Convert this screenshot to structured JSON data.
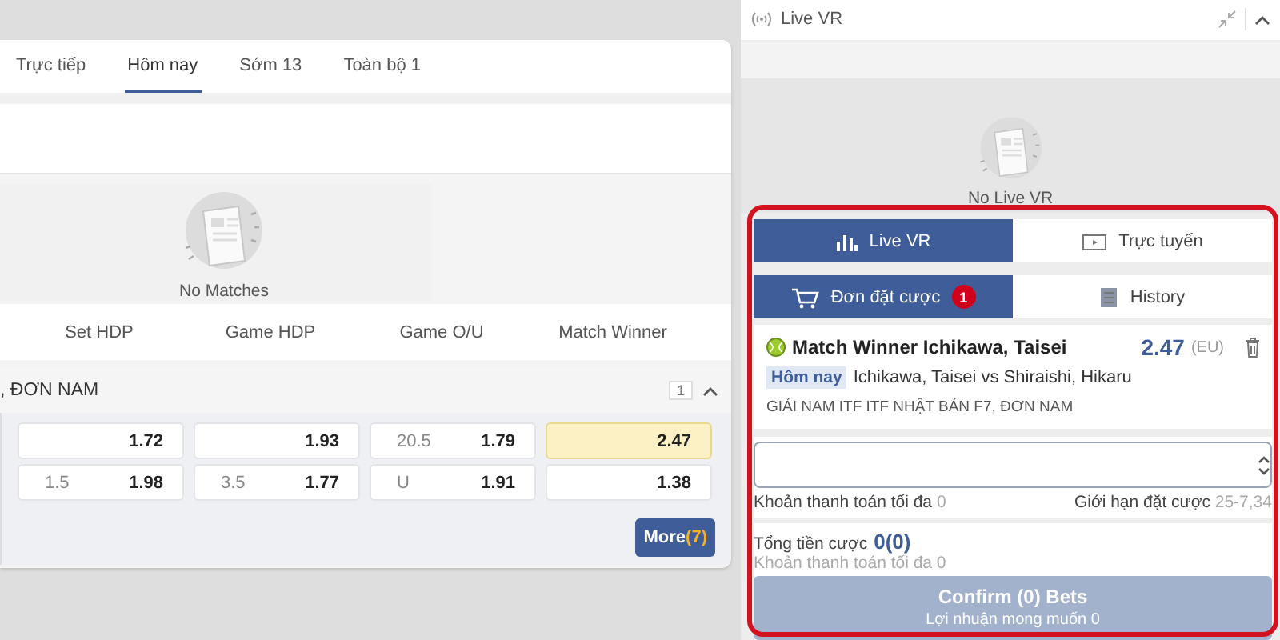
{
  "market_tabs": [
    {
      "label": "Trực tiếp",
      "selected": false
    },
    {
      "label": "Hôm nay",
      "selected": true
    },
    {
      "label": "Sớm 13",
      "selected": false
    },
    {
      "label": "Toàn bộ 1",
      "selected": false
    }
  ],
  "empty_state": {
    "message": "No Matches"
  },
  "columns": [
    "Set HDP",
    "Game HDP",
    "Game O/U",
    "Match Winner"
  ],
  "league": {
    "name": ", ĐƠN NAM",
    "count": "1",
    "expanded": true
  },
  "odds_rows": [
    [
      {
        "price": "1.72",
        "selected": false
      },
      {
        "price": "1.93",
        "selected": false
      },
      {
        "line": "20.5",
        "price": "1.79",
        "selected": false
      },
      {
        "price": "2.47",
        "selected": true
      }
    ],
    [
      {
        "line": "1.5",
        "price": "1.98",
        "selected": false
      },
      {
        "line": "3.5",
        "price": "1.77",
        "selected": false
      },
      {
        "line": "U",
        "price": "1.91",
        "selected": false
      },
      {
        "price": "1.38",
        "selected": false
      }
    ]
  ],
  "more_button": {
    "label": "More",
    "count": "(7)"
  },
  "live_vr": {
    "title": "Live VR",
    "empty_message": "No Live VR"
  },
  "view_tabs": [
    {
      "label": "Live VR",
      "selected": true
    },
    {
      "label": "Trực tuyến",
      "selected": false
    }
  ],
  "slip_tabs": [
    {
      "label": "Đơn đặt cược",
      "badge": "1",
      "selected": true
    },
    {
      "label": "History",
      "selected": false
    }
  ],
  "bet": {
    "title": "Match Winner Ichikawa, Taisei",
    "odds": "2.47",
    "odds_format": "(EU)",
    "date_tag": "Hôm nay",
    "match": "Ichikawa, Taisei vs Shiraishi, Hikaru",
    "league": "GIẢI NAM ITF ITF NHẬT BẢN F7, ĐƠN NAM",
    "max_payout_label": "Khoản thanh toán tối đa",
    "max_payout": "0",
    "limit_label": "Giới hạn đặt cược",
    "limit": "25-7,34"
  },
  "summary": {
    "total_label": "Tổng tiền cược",
    "total": "0(0)",
    "max_payout_label": "Khoản thanh toán tối đa",
    "max_payout": "0"
  },
  "confirm": {
    "label": "Confirm (0) Bets",
    "sublabel": "Lợi nhuận mong muốn 0",
    "disabled": true
  }
}
